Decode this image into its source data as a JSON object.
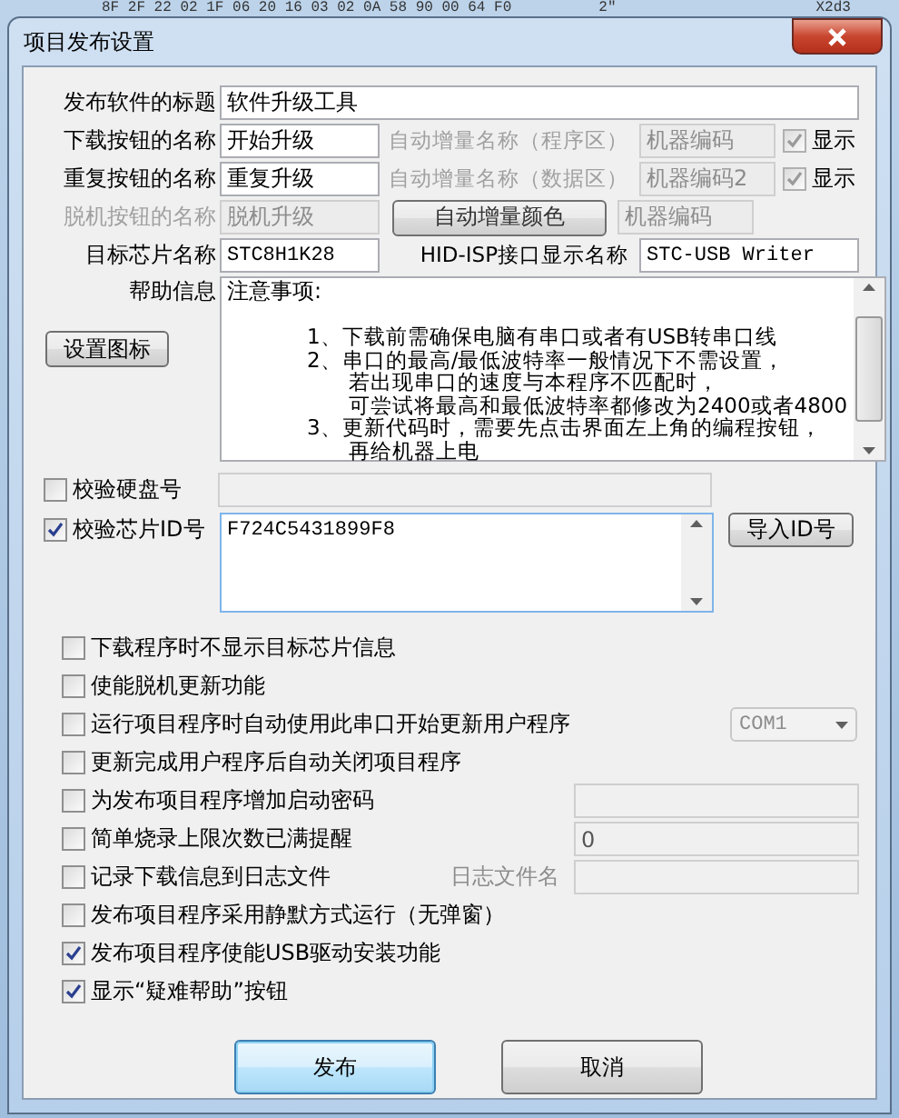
{
  "background_window": {
    "text": "8F 2F 22 02 1F 06 20 16 03 02 0A 58 90 00 64 F0",
    "text_2": "2\"",
    "text_3": "X2d3"
  },
  "window": {
    "title": "项目发布设置"
  },
  "rows": [
    {
      "kind": "wide",
      "label": "发布软件的标题",
      "disabled": false,
      "value": "软件升级工具"
    },
    {
      "kind": "counter",
      "label": "下载按钮的名称",
      "disabled": false,
      "value": "开始升级",
      "aux_label": "自动增量名称（程序区）",
      "aux_disabled": true,
      "aux_value": "机器编码",
      "show_label": "显示",
      "show_checked": true
    },
    {
      "kind": "counter",
      "label": "重复按钮的名称",
      "disabled": false,
      "value": "重复升级",
      "aux_label": "自动增量名称（数据区）",
      "aux_disabled": true,
      "aux_value": "机器编码2",
      "show_label": "显示",
      "show_checked": true
    },
    {
      "kind": "color",
      "label": "脱机按钮的名称",
      "disabled": true,
      "value": "脱机升级",
      "button": "自动增量颜色",
      "aux_disabled": true,
      "aux_value": "机器编码"
    },
    {
      "kind": "interface",
      "label": "目标芯片名称",
      "disabled": false,
      "value": "STC8H1K28",
      "aux_label": "HID-ISP接口显示名称",
      "aux_disabled": false,
      "aux_value": "STC-USB Writer"
    }
  ],
  "help": {
    "label": "帮助信息",
    "button": "设置图标",
    "lines": [
      {
        "kind": "heading",
        "text": "注意事项:"
      },
      {
        "kind": "blank"
      },
      {
        "kind": "item",
        "text": "1、下载前需确保电脑有串口或者有USB转串口线"
      },
      {
        "kind": "item",
        "text": "2、串口的最高/最低波特率一般情况下不需设置，"
      },
      {
        "kind": "continuation",
        "text": "若出现串口的速度与本程序不匹配时，"
      },
      {
        "kind": "continuation",
        "text": "可尝试将最高和最低波特率都修改为2400或者4800"
      },
      {
        "kind": "item",
        "text": "3、更新代码时，需要先点击界面左上角的编程按钮，"
      },
      {
        "kind": "continuation",
        "text": "再给机器上电"
      }
    ]
  },
  "disk_check": {
    "label": "校验硬盘号",
    "checked": false
  },
  "chip_id_check": {
    "label": "校验芯片ID号",
    "checked": true,
    "value": "F724C5431899F8",
    "button": "导入ID号"
  },
  "options": [
    {
      "kind": "plain",
      "label": "下载程序时不显示目标芯片信息",
      "checked": false
    },
    {
      "kind": "plain",
      "label": "使能脱机更新功能",
      "checked": false
    },
    {
      "kind": "combo",
      "label": "运行项目程序时自动使用此串口开始更新用户程序",
      "checked": false,
      "value": "COM1"
    },
    {
      "kind": "plain",
      "label": "更新完成用户程序后自动关闭项目程序",
      "checked": false
    },
    {
      "kind": "field",
      "label": "为发布项目程序增加启动密码",
      "checked": false
    },
    {
      "kind": "field",
      "label": "简单烧录上限次数已满提醒",
      "checked": false,
      "value": "0"
    },
    {
      "kind": "field",
      "label": "记录下载信息到日志文件",
      "checked": false,
      "field_label": "日志文件名"
    },
    {
      "kind": "plain",
      "label": "发布项目程序采用静默方式运行（无弹窗）",
      "checked": false
    },
    {
      "kind": "plain",
      "label": "发布项目程序使能USB驱动安装功能",
      "checked": true
    },
    {
      "kind": "plain",
      "label": "显示“疑难帮助”按钮",
      "checked": true
    }
  ],
  "buttons": [
    {
      "label": "发布",
      "default": true
    },
    {
      "label": "取消",
      "default": false
    }
  ]
}
